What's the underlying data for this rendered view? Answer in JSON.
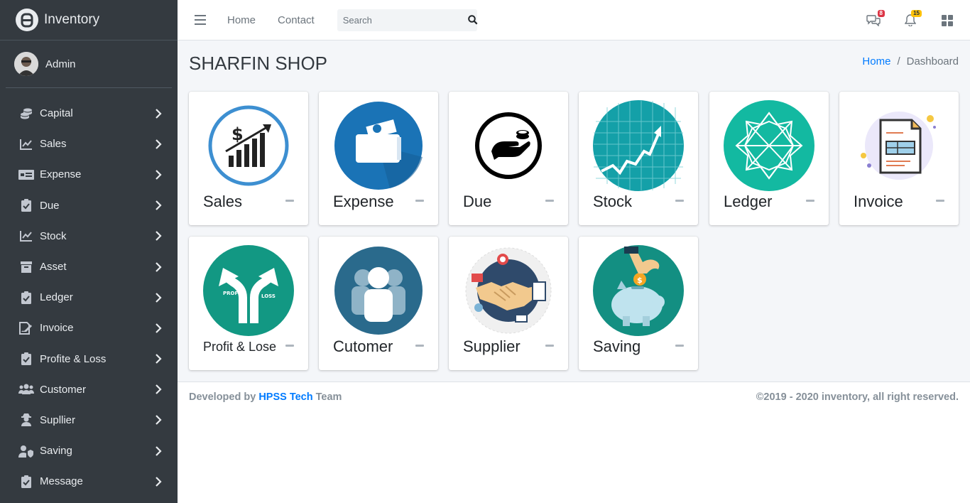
{
  "brand": {
    "name": "Inventory"
  },
  "user": {
    "name": "Admin"
  },
  "sidebar": {
    "items": [
      {
        "label": "Capital",
        "icon": "coins-icon"
      },
      {
        "label": "Sales",
        "icon": "chart-line-icon"
      },
      {
        "label": "Expense",
        "icon": "money-bill-icon"
      },
      {
        "label": "Due",
        "icon": "clipboard-check-icon"
      },
      {
        "label": "Stock",
        "icon": "chart-line-icon"
      },
      {
        "label": "Asset",
        "icon": "archive-icon"
      },
      {
        "label": "Ledger",
        "icon": "clipboard-check-icon"
      },
      {
        "label": "Invoice",
        "icon": "file-signature-icon"
      },
      {
        "label": "Profite & Loss",
        "icon": "clipboard-check-icon"
      },
      {
        "label": "Customer",
        "icon": "users-icon"
      },
      {
        "label": "Supllier",
        "icon": "user-secret-icon"
      },
      {
        "label": "Saving",
        "icon": "user-shield-icon"
      },
      {
        "label": "Message",
        "icon": "clipboard-check-icon"
      }
    ]
  },
  "topbar": {
    "links": [
      "Home",
      "Contact"
    ],
    "search": {
      "placeholder": "Search",
      "value": ""
    },
    "messages_badge": "8",
    "notifications_badge": "15"
  },
  "page": {
    "title": "SHARFIN SHOP",
    "breadcrumb": {
      "home": "Home",
      "separator": "/",
      "current": "Dashboard"
    }
  },
  "cards": [
    {
      "label": "Sales",
      "icon": "sales-growth-icon"
    },
    {
      "label": "Expense",
      "icon": "wallet-icon"
    },
    {
      "label": "Due",
      "icon": "hand-coins-icon"
    },
    {
      "label": "Stock",
      "icon": "stock-chart-icon"
    },
    {
      "label": "Ledger",
      "icon": "geometric-star-icon"
    },
    {
      "label": "Invoice",
      "icon": "invoice-document-icon"
    },
    {
      "label": "Profit & Lose",
      "icon": "profit-loss-arrows-icon",
      "arrow_left": "PROFIT",
      "arrow_right": "LOSS"
    },
    {
      "label": "Cutomer",
      "icon": "customer-group-icon"
    },
    {
      "label": "Supplier",
      "icon": "handshake-icon"
    },
    {
      "label": "Saving",
      "icon": "piggy-bank-icon"
    }
  ],
  "footer": {
    "prefix": "Developed by",
    "team_link": "HPSS Tech",
    "suffix": "Team",
    "copyright": "©2019 - 2020 inventory, all right reserved."
  },
  "colors": {
    "sidebar_bg": "#343a40",
    "content_bg": "#f4f6f9",
    "link": "#007bff",
    "badge_danger": "#dc3545",
    "badge_warning": "#ffc107"
  }
}
